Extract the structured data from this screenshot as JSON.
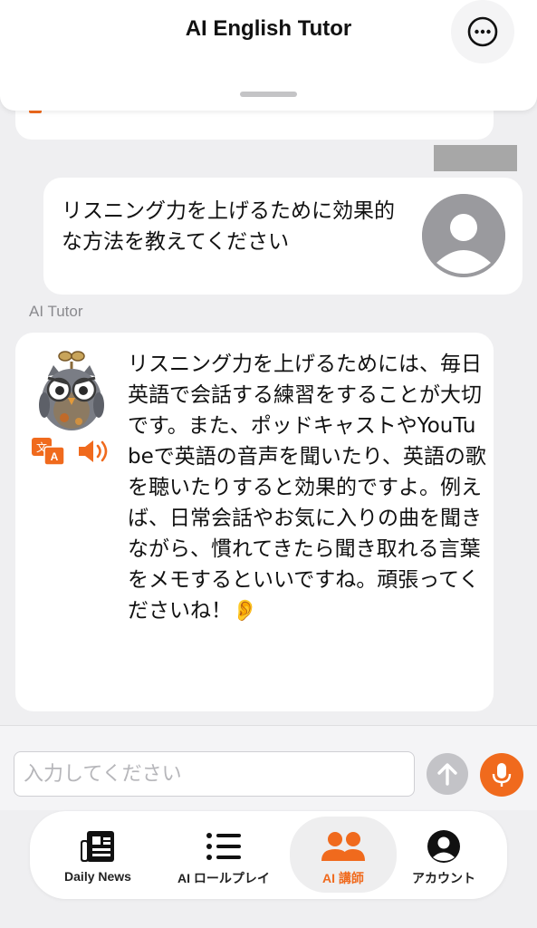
{
  "header": {
    "title": "AI English Tutor",
    "more_icon": "ellipsis-circle-icon"
  },
  "messages": {
    "user": {
      "text": "リスニング力を上げるために効果的な方法を教えてください",
      "avatar_icon": "person-avatar-icon"
    },
    "tutor_label": "AI Tutor",
    "ai": {
      "text": "リスニング力を上げるためには、毎日英語で会話する練習をすることが大切です。また、ポッドキャストやYouTubeで英語の音声を聞いたり、英語の歌を聴いたりすると効果的ですよ。例えば、日常会話やお気に入りの曲を聞きながら、慣れてきたら聞き取れる言葉をメモするといいですね。頑張ってくださいね！👂",
      "avatar_icon": "owl-tutor-icon",
      "translate_icon": "translate-icon",
      "speaker_icon": "speaker-icon"
    }
  },
  "input": {
    "placeholder": "入力してください",
    "value": "",
    "send_icon": "arrow-up-icon",
    "mic_icon": "microphone-icon"
  },
  "tabs": [
    {
      "label": "Daily News",
      "icon": "newspaper-icon",
      "active": false
    },
    {
      "label": "AI ロールプレイ",
      "icon": "list-icon",
      "active": false
    },
    {
      "label": "AI 講師",
      "icon": "people-icon",
      "active": true
    },
    {
      "label": "アカウント",
      "icon": "account-icon",
      "active": false
    }
  ],
  "colors": {
    "accent": "#f06a1d",
    "background": "#efeff1",
    "bubble": "#ffffff",
    "muted": "#8a8a8e"
  }
}
